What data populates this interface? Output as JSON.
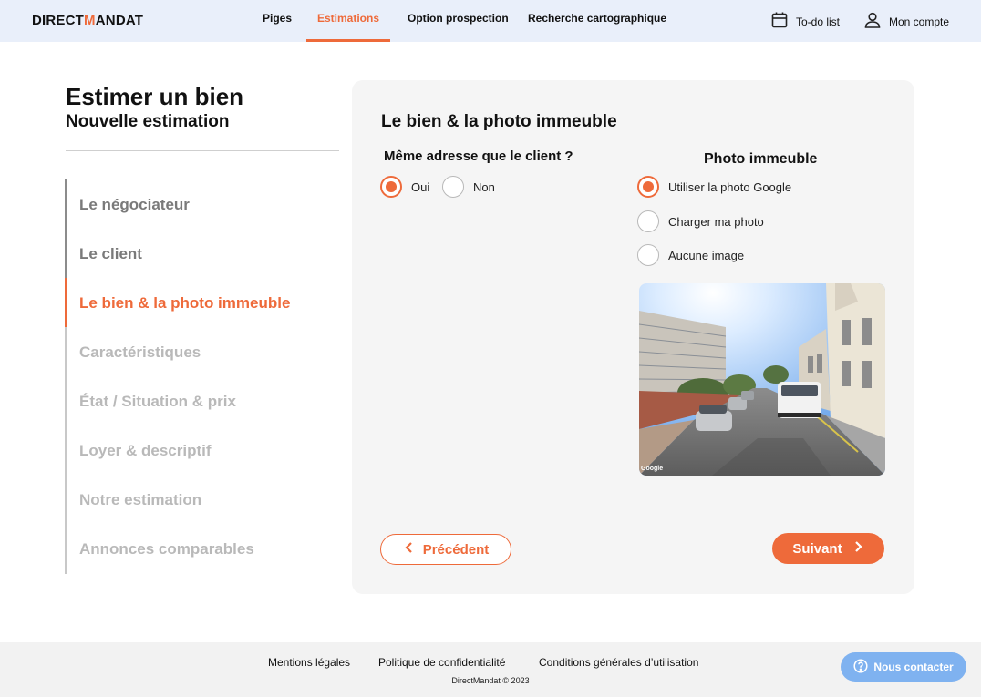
{
  "header": {
    "logo_part1": "DIRECT",
    "logo_m": "M",
    "logo_part2": "ANDAT",
    "nav": [
      "Piges",
      "Estimations",
      "Option prospection",
      "Recherche cartographique"
    ],
    "active_nav": "Estimations",
    "todo_label": "To-do list",
    "account_label": "Mon compte"
  },
  "page": {
    "title": "Estimer un bien",
    "subtitle": "Nouvelle estimation"
  },
  "steps": [
    {
      "label": "Le négociateur",
      "state": "done"
    },
    {
      "label": "Le client",
      "state": "done"
    },
    {
      "label": "Le bien & la photo immeuble",
      "state": "active"
    },
    {
      "label": "Caractéristiques",
      "state": "todo"
    },
    {
      "label": "État / Situation & prix",
      "state": "todo"
    },
    {
      "label": "Loyer & descriptif",
      "state": "todo"
    },
    {
      "label": "Notre estimation",
      "state": "todo"
    },
    {
      "label": "Annonces comparables",
      "state": "todo"
    }
  ],
  "form": {
    "title": "Le bien & la photo immeuble",
    "same_address_question": "Même adresse que le client ?",
    "same_address_options": [
      {
        "label": "Oui",
        "checked": true
      },
      {
        "label": "Non",
        "checked": false
      }
    ],
    "photo_title": "Photo immeuble",
    "photo_options": [
      {
        "label": "Utiliser la photo Google",
        "checked": true
      },
      {
        "label": "Charger ma photo",
        "checked": false
      },
      {
        "label": "Aucune image",
        "checked": false
      }
    ],
    "photo_watermark": "Google",
    "prev_label": "Précédent",
    "next_label": "Suivant"
  },
  "footer": {
    "links": [
      "Mentions légales",
      "Politique de confidentialité",
      "Conditions générales d’utilisation"
    ],
    "copyright": "DirectMandat © 2023",
    "contact_label": "Nous contacter"
  },
  "colors": {
    "accent": "#ee6a3a",
    "header_bg": "#e9effa",
    "card_bg": "#f5f5f5",
    "contact_bg": "#7fb2f0"
  }
}
